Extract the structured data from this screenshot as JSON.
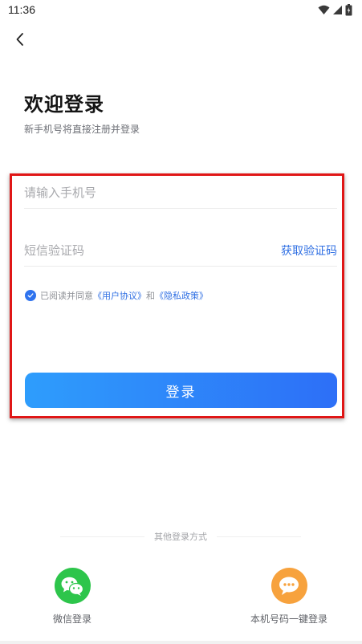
{
  "status_bar": {
    "time": "11:36",
    "icons": [
      "wifi-icon",
      "signal-icon",
      "battery-icon"
    ]
  },
  "header": {
    "back_icon": "back-arrow-icon",
    "title": "欢迎登录",
    "subtitle": "新手机号将直接注册并登录"
  },
  "form": {
    "phone_placeholder": "请输入手机号",
    "phone_value": "",
    "code_placeholder": "短信验证码",
    "code_value": "",
    "get_code_label": "获取验证码"
  },
  "agreement": {
    "checked": true,
    "prefix": "已阅读并同意",
    "user_agreement": "《用户协议》",
    "and": "和",
    "privacy_policy": "《隐私政策》"
  },
  "login_button": {
    "label": "登录"
  },
  "other_login": {
    "divider_label": "其他登录方式",
    "options": [
      {
        "label": "微信登录",
        "icon": "wechat-icon",
        "color": "#2dc54b"
      },
      {
        "label": "本机号码一键登录",
        "icon": "chat-bubble-icon",
        "color": "#f7a23d"
      }
    ]
  },
  "colors": {
    "accent": "#2f6fe3",
    "button_gradient_start": "#2e9dfc",
    "button_gradient_end": "#2d6ff7",
    "highlight_border": "#e01616"
  }
}
